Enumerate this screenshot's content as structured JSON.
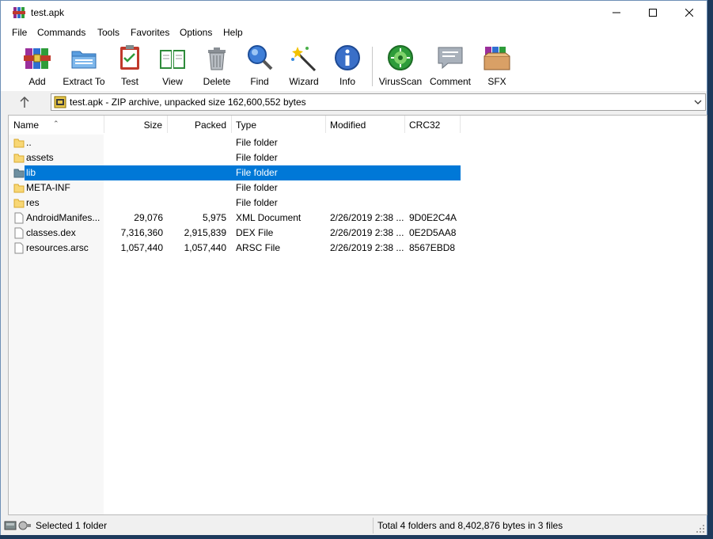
{
  "window": {
    "title": "test.apk"
  },
  "menu": [
    "File",
    "Commands",
    "Tools",
    "Favorites",
    "Options",
    "Help"
  ],
  "toolbar": [
    {
      "label": "Add",
      "icon": "add-archive-icon"
    },
    {
      "label": "Extract To",
      "icon": "extract-folder-icon"
    },
    {
      "label": "Test",
      "icon": "test-clipboard-icon"
    },
    {
      "label": "View",
      "icon": "view-book-icon"
    },
    {
      "label": "Delete",
      "icon": "trash-can-icon"
    },
    {
      "label": "Find",
      "icon": "magnifier-icon"
    },
    {
      "label": "Wizard",
      "icon": "magic-wand-icon"
    },
    {
      "label": "Info",
      "icon": "info-icon"
    },
    {
      "label": "VirusScan",
      "icon": "virus-scan-icon"
    },
    {
      "label": "Comment",
      "icon": "comment-bubble-icon"
    },
    {
      "label": "SFX",
      "icon": "sfx-box-icon"
    }
  ],
  "address": {
    "text": "test.apk - ZIP archive, unpacked size 162,600,552 bytes"
  },
  "columns": [
    "Name",
    "Size",
    "Packed",
    "Type",
    "Modified",
    "CRC32"
  ],
  "rows": [
    {
      "name": "..",
      "size": "",
      "packed": "",
      "type": "File folder",
      "modified": "",
      "crc": "",
      "kind": "folder"
    },
    {
      "name": "assets",
      "size": "",
      "packed": "",
      "type": "File folder",
      "modified": "",
      "crc": "",
      "kind": "folder"
    },
    {
      "name": "lib",
      "size": "",
      "packed": "",
      "type": "File folder",
      "modified": "",
      "crc": "",
      "kind": "folder"
    },
    {
      "name": "META-INF",
      "size": "",
      "packed": "",
      "type": "File folder",
      "modified": "",
      "crc": "",
      "kind": "folder"
    },
    {
      "name": "res",
      "size": "",
      "packed": "",
      "type": "File folder",
      "modified": "",
      "crc": "",
      "kind": "folder"
    },
    {
      "name": "AndroidManifes...",
      "size": "29,076",
      "packed": "5,975",
      "type": "XML Document",
      "modified": "2/26/2019 2:38 ...",
      "crc": "9D0E2C4A",
      "kind": "file"
    },
    {
      "name": "classes.dex",
      "size": "7,316,360",
      "packed": "2,915,839",
      "type": "DEX File",
      "modified": "2/26/2019 2:38 ...",
      "crc": "0E2D5AA8",
      "kind": "file"
    },
    {
      "name": "resources.arsc",
      "size": "1,057,440",
      "packed": "1,057,440",
      "type": "ARSC File",
      "modified": "2/26/2019 2:38 ...",
      "crc": "8567EBD8",
      "kind": "file"
    }
  ],
  "status": {
    "left": "Selected 1 folder",
    "right": "Total 4 folders and 8,402,876 bytes in 3 files"
  },
  "colors": {
    "selection": "#0078d7",
    "folder": "#f8d775"
  }
}
